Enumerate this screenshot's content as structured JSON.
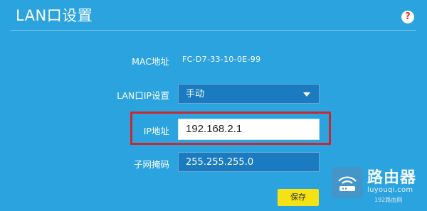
{
  "page": {
    "title": "LAN口设置",
    "help_symbol": "?"
  },
  "fields": {
    "mac_label": "MAC地址",
    "mac_value": "FC-D7-33-10-0E-99",
    "lan_ip_label": "LAN口IP设置",
    "lan_ip_mode": "手动",
    "ip_label": "IP地址",
    "ip_value": "192.168.2.1",
    "mask_label": "子网掩码",
    "mask_value": "255.255.255.0"
  },
  "actions": {
    "save_label": "保存"
  },
  "watermark": {
    "name": "路由器",
    "url": "luyouqi.com",
    "small": "192路由网"
  },
  "colors": {
    "background": "#2aa3df",
    "field_bg": "#1a7bc0",
    "highlight_border": "#c8282e",
    "save_button": "#f4e215",
    "help_icon_color": "#e2352b"
  },
  "icons": {
    "help": "help-icon",
    "dropdown": "chevron-down-icon",
    "watermark_logo": "router-wifi-icon"
  }
}
